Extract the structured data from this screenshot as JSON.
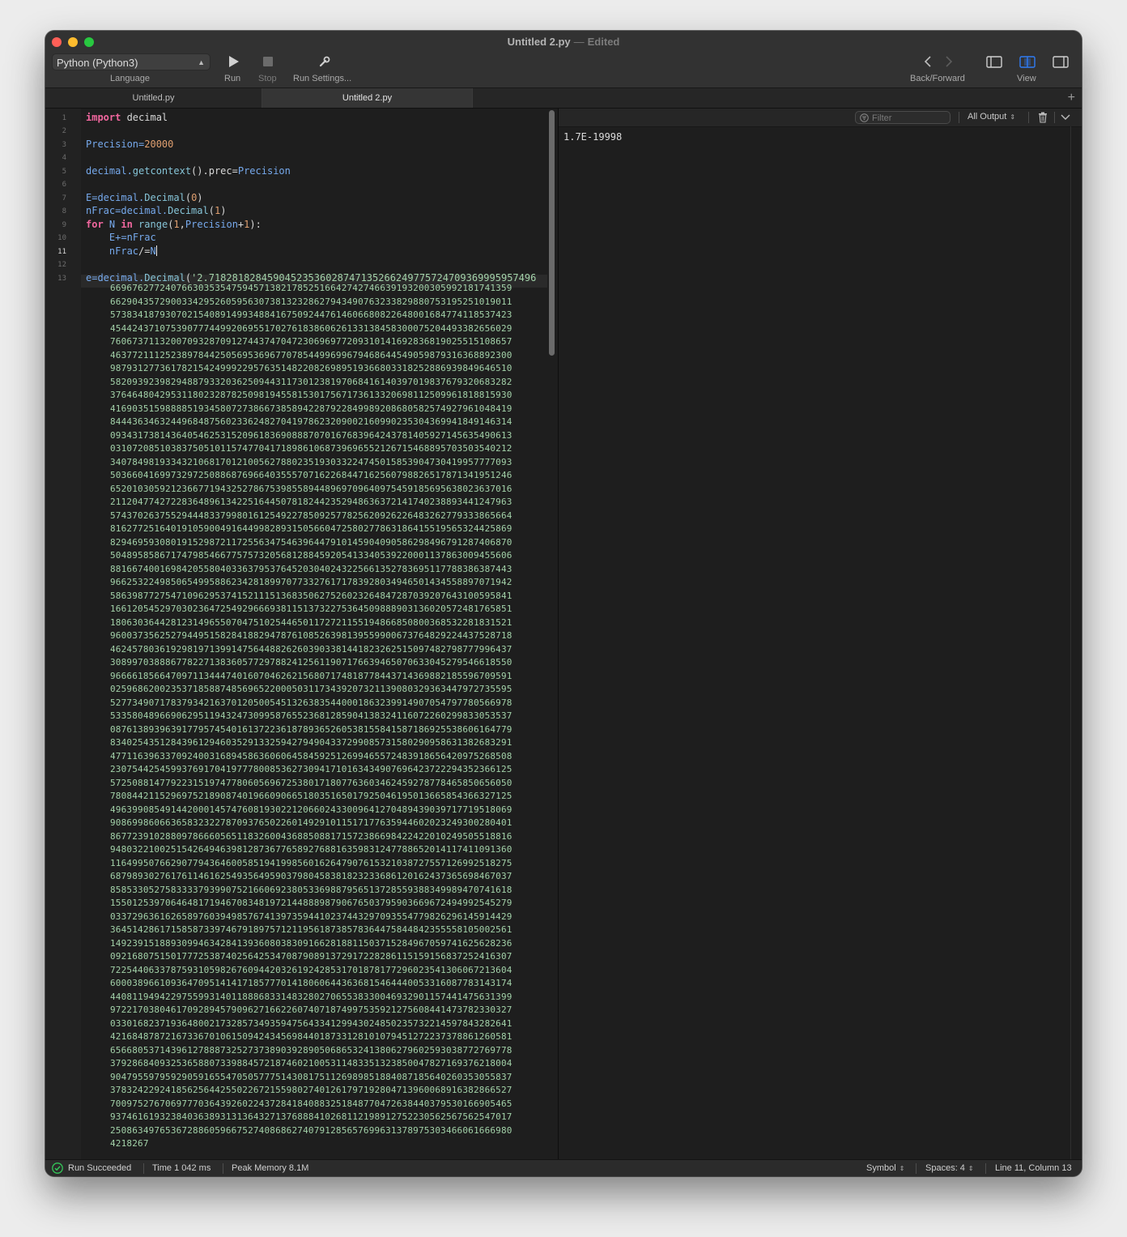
{
  "window": {
    "file_name": "Untitled 2.py",
    "title_separator": "—",
    "edit_status": "Edited"
  },
  "toolbar": {
    "language_value": "Python (Python3)",
    "language_label": "Language",
    "run_label": "Run",
    "stop_label": "Stop",
    "run_settings_label": "Run Settings...",
    "back_forward_label": "Back/Forward",
    "view_label": "View"
  },
  "tabs": [
    {
      "label": "Untitled.py",
      "active": false
    },
    {
      "label": "Untitled 2.py",
      "active": true
    }
  ],
  "editor": {
    "current_line": 11,
    "line_numbers": [
      "1",
      "2",
      "3",
      "4",
      "5",
      "6",
      "7",
      "8",
      "9",
      "10",
      "11",
      "12",
      "13"
    ],
    "code": {
      "l1_kw": "import",
      "l1_mod": " decimal",
      "l3_id": "Precision=",
      "l3_num": "20000",
      "l5_a": "decimal.",
      "l5_fn": "getcontext",
      "l5_b": "().prec=",
      "l5_id": "Precision",
      "l7_a": "E=decimal.",
      "l7_fn": "Decimal",
      "l7_b": "(",
      "l7_num": "0",
      "l7_c": ")",
      "l8_a": "nFrac=decimal.",
      "l8_fn": "Decimal",
      "l8_b": "(",
      "l8_num": "1",
      "l8_c": ")",
      "l9_kw1": "for",
      "l9_var": " N ",
      "l9_kw2": "in",
      "l9_fn": " range",
      "l9_b": "(",
      "l9_n1": "1",
      "l9_c": ",",
      "l9_id": "Precision",
      "l9_d": "+",
      "l9_n2": "1",
      "l9_e": "):",
      "l10_indent": "    ",
      "l10_a": "E+=",
      "l10_id": "nFrac",
      "l11_indent": "    ",
      "l11_id": "nFrac",
      "l11_a": "/=",
      "l11_var": "N",
      "l13_a": "e=decimal.",
      "l13_fn": "Decimal",
      "l13_b": "(",
      "l13_str": "'2.71828182845904523536028747135266249775724709369995957496"
    },
    "digit_lines": [
      "6696762772407663035354759457138217852516642742746639193200305992181741359",
      "6629043572900334295260595630738132328627943490763233829880753195251019011",
      "5738341879307021540891499348841675092447614606680822648001684774118537423",
      "4544243710753907774499206955170276183860626133138458300075204493382656029",
      "7606737113200709328709127443747047230696977209310141692836819025515108657",
      "4637721112523897844250569536967707854499699679468644549059879316368892300",
      "9879312773617821542499922957635148220826989519366803318252886939849646510",
      "5820939239829488793320362509443117301238197068416140397019837679320683282",
      "3764648042953118023287825098194558153017567173613320698112509961818815930",
      "4169035159888851934580727386673858942287922849989208680582574927961048419",
      "8444363463244968487560233624827041978623209002160990235304369941849146314",
      "0934317381436405462531520961836908887070167683964243781405927145635490613",
      "0310720851038375051011574770417189861068739696552126715468895703503540212",
      "3407849819334321068170121005627880235193033224745015853904730419957777093",
      "5036604169973297250886876966403555707162268447162560798826517871341951246",
      "6520103059212366771943252786753985589448969709640975459185695638023637016",
      "2112047742722836489613422516445078182442352948636372141740238893441247963",
      "5743702637552944483379980161254922785092577825620926226483262779333865664",
      "8162772516401910590049164499828931505660472580277863186415519565324425869",
      "8294695930801915298721172556347546396447910145904090586298496791287406870",
      "5048958586717479854667757573205681288459205413340539220001137863009455606",
      "8816674001698420558040336379537645203040243225661352783695117788386387443",
      "9662532249850654995886234281899707733276171783928034946501434558897071942",
      "5863987727547109629537415211151368350627526023264847287039207643100595841",
      "1661205452970302364725492966693811513732275364509888903136020572481765851",
      "1806303644281231496550704751025446501172721155194866850800368532281831521",
      "9600373562527944951582841882947876108526398139559900673764829224437528718",
      "4624578036192981971399147564488262603903381441823262515097482798777996437",
      "3089970388867782271383605772978824125611907176639465070633045279546618550",
      "9666618566470971134447401607046262156807174818778443714369882185596709591",
      "0259686200235371858874856965220005031173439207321139080329363447972735595",
      "5277349071783793421637012050054513263835440001863239914907054797780566978",
      "5335804896690629511943247309958765523681285904138324116072260299833053537",
      "0876138939639177957454016137223618789365260538155841587186925538606164779",
      "8340254351284396129460352913325942794904337299085731580290958631382683291",
      "4771163963370924003168945863606064584592512699465572483918656420975268508",
      "2307544254599376917041977780085362730941710163434907696423722294352366125",
      "5725088147792231519747780605696725380171807763603462459278778465850656050",
      "7808442115296975218908740196609066518035165017925046195013665854366327125",
      "4963990854914420001457476081930221206602433009641270489439039717719518069",
      "9086998606636583232278709376502260149291011517177635944602023249300280401",
      "8677239102880978666056511832600436885088171572386698422422010249505518816",
      "9480322100251542649463981287367765892768816359831247788652014117411091360",
      "1164995076629077943646005851941998560162647907615321038727557126992518275",
      "6879893027617611461625493564959037980458381823233686120162437365698467037",
      "8585330527583333793990752166069238053369887956513728559388349989470741618",
      "1550125397064648171946708348197214488898790676503795903669672494992545279",
      "0337296361626589760394985767413973594410237443297093554779826296145914429",
      "3645142861715858733974679189757121195618738578364475844842355558105002561",
      "1492391518893099463428413936080383091662818811503715284967059741625628236",
      "0921680751501777253874025642534708790891372917228286115159156837252416307",
      "7225440633787593105982676094420326192428531701878177296023541306067213604",
      "6000389661093647095141417185777014180606443636815464440053316087783143174",
      "4408119494229755993140118886833148328027065538330046932901157441475631399",
      "9722170380461709289457909627166226074071874997535921275608441473782330327",
      "0330168237193648002173285734935947564334129943024850235732214597843282641",
      "4216848787216733670106150942434569844018733128101079451272237378861260581",
      "6566805371439612788873252737389039289050686532413806279602593038772769778",
      "3792868409325365880733988457218746021005311483351323850047827169376218004",
      "9047955979592905916554705057775143081751126989851884087185640260353055837",
      "3783242292418562564425502267215598027401261797192804713960068916382866527",
      "7009752767069777036439260224372841840883251848770472638440379530166905465",
      "9374616193238403638931313643271376888410268112198912752230562567562547017",
      "2508634976536728860596675274086862740791285657699631378975303466061666980",
      "4218267"
    ]
  },
  "console": {
    "filter_placeholder": "Filter",
    "output_select": "All Output",
    "output_text": "1.7E-19998"
  },
  "statusbar": {
    "run_status": "Run Succeeded",
    "time": "Time 1 042 ms",
    "peak_memory": "Peak Memory 8.1M",
    "symbol": "Symbol",
    "spaces": "Spaces: 4",
    "cursor": "Line 11, Column 13"
  },
  "colors": {
    "keyword": "#f2679f",
    "number": "#e0a070",
    "string_digits": "#a3d2a9",
    "success": "#34c759",
    "accent": "#2f7cf6"
  }
}
